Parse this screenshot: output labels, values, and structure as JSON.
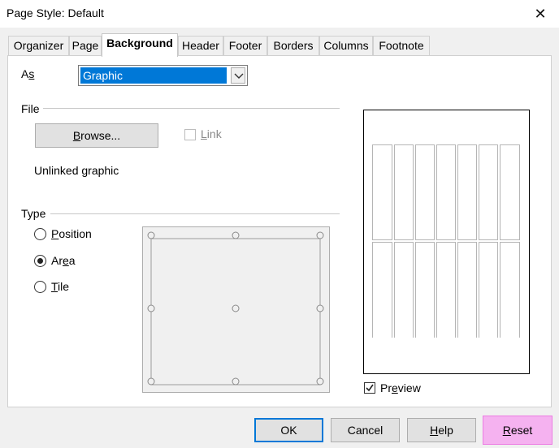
{
  "window": {
    "title": "Page Style: Default",
    "close_glyph": "✕"
  },
  "tabs": [
    {
      "label": "Organizer",
      "active": false
    },
    {
      "label": "Page",
      "active": false
    },
    {
      "label": "Background",
      "active": true
    },
    {
      "label": "Header",
      "active": false
    },
    {
      "label": "Footer",
      "active": false
    },
    {
      "label": "Borders",
      "active": false
    },
    {
      "label": "Columns",
      "active": false
    },
    {
      "label": "Footnote",
      "active": false
    }
  ],
  "background": {
    "as_label_pre": "A",
    "as_label_key": "s",
    "as_value": "Graphic",
    "file_section": "File",
    "browse_key": "B",
    "browse_rest": "rowse...",
    "link_key": "L",
    "link_rest": "ink",
    "link_checked": false,
    "file_status": "Unlinked graphic",
    "type_section": "Type",
    "types": [
      {
        "key": "P",
        "rest": "osition",
        "pre": "",
        "selected": false
      },
      {
        "key": "e",
        "rest": "a",
        "pre": "Ar",
        "selected": true
      },
      {
        "key": "T",
        "rest": "ile",
        "pre": "",
        "selected": false
      }
    ],
    "preview_key": "e",
    "preview_pre": "Pr",
    "preview_rest": "view",
    "preview_checked": true
  },
  "buttons": {
    "ok": "OK",
    "cancel": "Cancel",
    "help_key": "H",
    "help_rest": "elp",
    "reset_key": "R",
    "reset_rest": "eset"
  },
  "colors": {
    "accent": "#0078d7",
    "highlight": "#f5b2f0"
  }
}
